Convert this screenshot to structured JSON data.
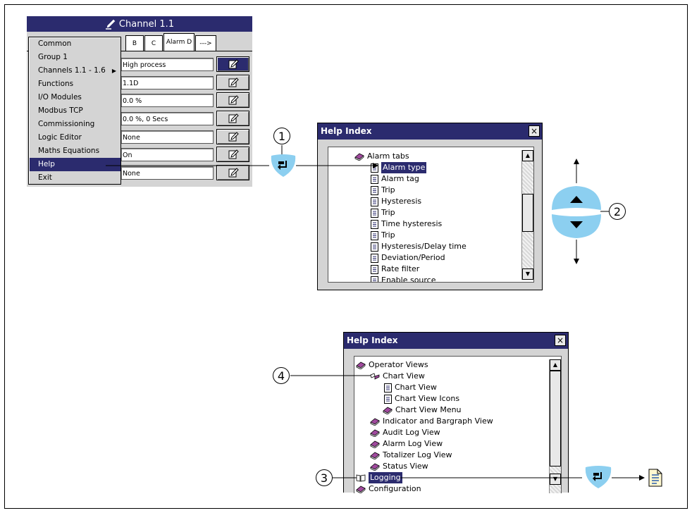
{
  "channel_window": {
    "title": "Channel 1.1",
    "tabs": [
      "B",
      "C",
      "Alarm D",
      "--->"
    ],
    "fields": [
      "High process",
      "1.1D",
      "0.0 %",
      "0.0 %, 0 Secs",
      "None",
      "On",
      "None"
    ]
  },
  "context_menu": {
    "items": [
      "Common",
      "Group 1",
      "Channels 1.1 - 1.6",
      "Functions",
      "I/O Modules",
      "Modbus TCP",
      "Commissioning",
      "Logic Editor",
      "Maths Equations",
      "Help",
      "Exit"
    ],
    "selected": "Help"
  },
  "help_index_1": {
    "title": "Help Index",
    "close": "×",
    "items": [
      "Alarm tabs",
      "Alarm type",
      "Alarm tag",
      "Trip",
      "Hysteresis",
      "Trip",
      "Time hysteresis",
      "Trip",
      "Hysteresis/Delay time",
      "Deviation/Period",
      "Rate filter",
      "Enable source"
    ]
  },
  "help_index_2": {
    "title": "Help Index",
    "close": "×",
    "items": [
      "Operator Views",
      "Chart View",
      "Chart View",
      "Chart View Icons",
      "Chart View Menu",
      "Indicator and Bargraph View",
      "Audit Log View",
      "Alarm Log View",
      "Totalizer Log View",
      "Status View",
      "Logging",
      "Configuration"
    ]
  },
  "callouts": [
    "1",
    "2",
    "3",
    "4"
  ],
  "colors": {
    "titlebar": "#2b2b6e",
    "key_blue": "#8ccff0",
    "book": "#a04a9e"
  }
}
